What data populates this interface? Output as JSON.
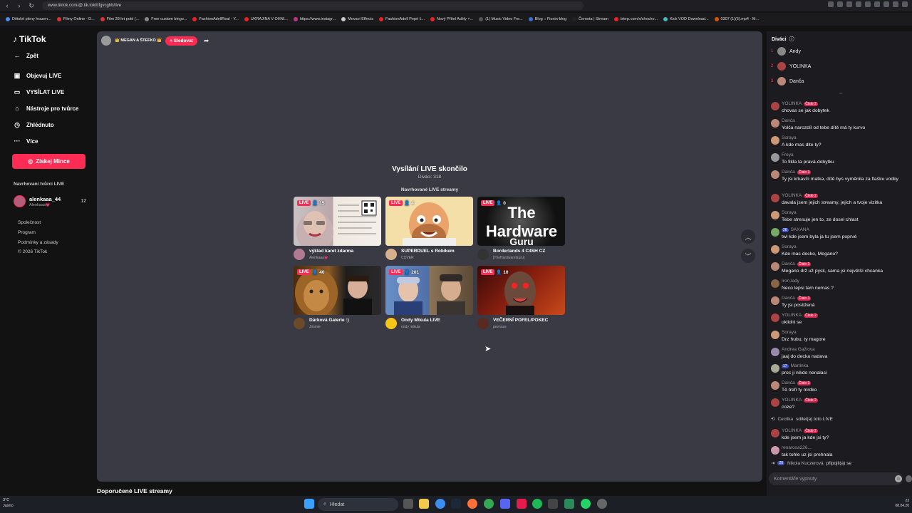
{
  "browser": {
    "url": "www.tiktok.com/@.tik.toktttfgvcghb/live",
    "bookmarks": [
      "Dětské pleny hrazen...",
      "Filmy Online - D...",
      "Film 28 let poté (...",
      "Free custom bingo...",
      "FashionAdellReal - Y...",
      "UKRAJINA V OHNI...",
      "https://www.instagr...",
      "Movavi Effects",
      "FashionAdell Pepé č...",
      "Nový Přítel Adély +...",
      "(1) Music Video Fre...",
      "Blog :: Fionin-blog",
      "Černota | Stream",
      "blerp.com/x/chocho...",
      "Kick VOD Download...",
      "0307 (1)(5).mp4 - M..."
    ]
  },
  "sidebar": {
    "logo": "TikTok",
    "back": "Zpět",
    "nav": [
      {
        "label": "Objevuj LIVE",
        "icon": "live-discover-icon"
      },
      {
        "label": "VYSÍLAT LIVE",
        "icon": "camera-icon"
      },
      {
        "label": "Nástroje pro tvůrce",
        "icon": "home-tools-icon"
      },
      {
        "label": "Zhlédnuto",
        "icon": "history-icon"
      },
      {
        "label": "Více",
        "icon": "more-icon"
      }
    ],
    "coins_button": "Získej Mince",
    "suggested_title": "Navrhovaní tvůrci LIVE",
    "creator": {
      "name": "alenkaaa_44",
      "sub": "Alenkaaa💗",
      "count": "12"
    },
    "footer": [
      "Společnost",
      "Program",
      "Podmínky a zásady",
      "© 2026 TikTok"
    ]
  },
  "main": {
    "host_name": "👑 MEGAN A ŠTEFKO 👑",
    "follow_label": "+ Sledovat",
    "ended_title": "Vysílání LIVE skončilo",
    "ended_viewers": "Diváci: 318",
    "recommended_title": "Navrhované LIVE streamy",
    "live_label": "LIVE",
    "cards": [
      {
        "viewers": "15",
        "title": "výklad karet zdarma",
        "sub": "Alenkaaa💗"
      },
      {
        "viewers": "4",
        "title": "SUPERDUEL s Robikem",
        "sub": "COVER"
      },
      {
        "viewers": "0",
        "title": "Borderlands 4 C4SH CZ",
        "sub": "[TheHardwareGuru]"
      },
      {
        "viewers": "40",
        "title": "Dárková Galerie :)",
        "sub": "Jimmie"
      },
      {
        "viewers": "201",
        "title": "Ondy Mikula LIVE",
        "sub": "ondy mikula"
      },
      {
        "viewers": "10",
        "title": "VEČERNÍ POFEL/POKEC",
        "sub": "pevnoss"
      }
    ],
    "thumb3_text": "The Hardware Guru",
    "bottom_section": "Doporučené LIVE streamy"
  },
  "chat": {
    "viewers_title": "Diváci",
    "top_viewers": [
      {
        "rank": "1",
        "name": "Andy"
      },
      {
        "rank": "2",
        "name": "YOLINKA"
      },
      {
        "rank": "3",
        "name": "Danča"
      }
    ],
    "messages": [
      {
        "user": "YOLINKA",
        "badge": "Číslo 2",
        "text": "chovas se jak dobytek"
      },
      {
        "user": "Danča",
        "badge": "",
        "text": "Yolča narozdíl od tebe dítě má ty kurvo"
      },
      {
        "user": "Soraya",
        "badge": "",
        "text": "A kde mas dite ty?"
      },
      {
        "user": "Freya",
        "badge": "",
        "text": "To fikla ta pravá-dobytku"
      },
      {
        "user": "Danča",
        "badge": "Číslo 3",
        "text": "Ty jsi krkavčí matka, dítě bys vyměnila za flašku vodky"
      },
      {
        "user": "YOLINKA",
        "badge": "Číslo 2",
        "text": "davala jsem jejich streamy, jejich a tvoje vizitka"
      },
      {
        "user": "Soraya",
        "badge": "",
        "text": "Tebe stresuje jen to, ze dosel chlast"
      },
      {
        "user": "SAXANA",
        "badge": "",
        "level": "26",
        "text": "twl kde jsem byla ja tu jsem poprvé"
      },
      {
        "user": "Soraya",
        "badge": "",
        "text": "Kde mas decko, Megano?"
      },
      {
        "user": "Danča",
        "badge": "Číslo 3",
        "text": "Megano drž už pysk, sama jsi největší chcanka"
      },
      {
        "user": "Iron.lady",
        "badge": "",
        "text": "Neco lepsi tam nemas ?"
      },
      {
        "user": "Danča",
        "badge": "Číslo 3",
        "text": "Ty jsi postižená"
      },
      {
        "user": "YOLINKA",
        "badge": "Číslo 2",
        "text": "uklidni se"
      },
      {
        "user": "Soraya",
        "badge": "",
        "text": "Drz hubu, ty magore"
      },
      {
        "user": "Andrea Gažiova",
        "badge": "",
        "text": "jaaj do decka nadava"
      },
      {
        "user": "Martinka",
        "badge": "",
        "level": "17",
        "text": "proc ji nikdo nenalasi"
      },
      {
        "user": "Danča",
        "badge": "Číslo 3",
        "text": "Tě trefí ty mrdko"
      },
      {
        "user": "YOLINKA",
        "badge": "Číslo 2",
        "text": "coze?"
      }
    ],
    "share_msg": {
      "user": "Cecílka",
      "text": "sdílel(a) toto LIVE"
    },
    "after_share": [
      {
        "user": "YOLINKA",
        "badge": "Číslo 2",
        "text": "kde jsem ja kde jsi ty?"
      },
      {
        "user": "renarosa226...",
        "badge": "",
        "text": "tak tohle uz jsi prehnala"
      }
    ],
    "join_msg": {
      "level": "20",
      "user": "Nikola Kuczerová",
      "text": "připojil(a) se"
    },
    "comment_placeholder": "Komentáře vypnuty"
  },
  "taskbar": {
    "temp": "3°C",
    "weather": "Jasno",
    "search": "Hledat",
    "time": "23",
    "date": "08.04.20"
  },
  "colors": {
    "accent": "#fe2c55",
    "panel": "#3a3a45",
    "bg": "#121212"
  }
}
